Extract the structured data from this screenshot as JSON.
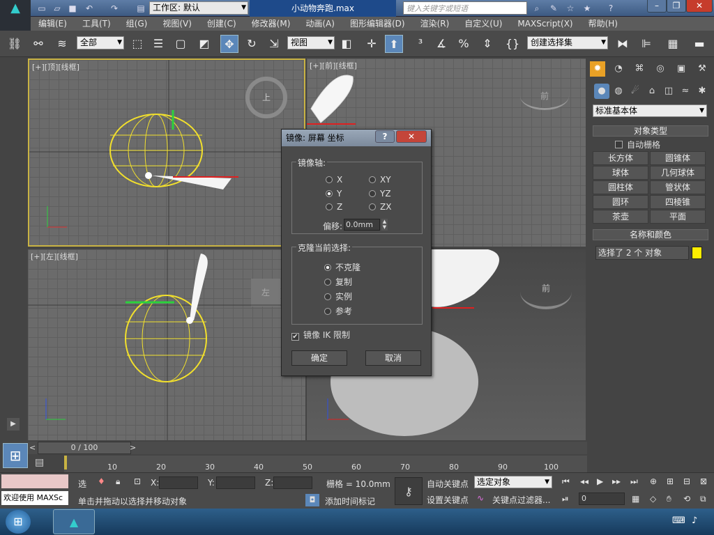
{
  "titlebar": {
    "workspace_label": "工作区: 默认",
    "file_title": "小动物奔跑.max",
    "search_placeholder": "键入关键字或短语"
  },
  "menu": [
    "编辑(E)",
    "工具(T)",
    "组(G)",
    "视图(V)",
    "创建(C)",
    "修改器(M)",
    "动画(A)",
    "图形编辑器(D)",
    "渲染(R)",
    "自定义(U)",
    "MAXScript(X)",
    "帮助(H)"
  ],
  "toolbar": {
    "filter_value": "全部",
    "refcoord_value": "视图",
    "selection_set_value": "创建选择集"
  },
  "viewports": {
    "top": {
      "label": "[+][顶][线框]",
      "cube": "上"
    },
    "front": {
      "label": "[+][前][线框]",
      "cube": "前"
    },
    "left": {
      "label": "[+][左][线框]",
      "cube": "左"
    },
    "persp": {
      "cube": "前"
    }
  },
  "command_panel": {
    "category": "标准基本体",
    "object_type_title": "对象类型",
    "autogrid_label": "自动栅格",
    "primitives": [
      "长方体",
      "圆锥体",
      "球体",
      "几何球体",
      "圆柱体",
      "管状体",
      "圆环",
      "四棱锥",
      "茶壶",
      "平面"
    ],
    "name_color_title": "名称和颜色",
    "name_value": "选择了 2 个 对象",
    "color": "#ffee00"
  },
  "dialog": {
    "title": "镜像: 屏幕 坐标",
    "mirror_axis_label": "镜像轴:",
    "axes": [
      {
        "label": "X",
        "checked": false
      },
      {
        "label": "XY",
        "checked": false
      },
      {
        "label": "Y",
        "checked": true
      },
      {
        "label": "YZ",
        "checked": false
      },
      {
        "label": "Z",
        "checked": false
      },
      {
        "label": "ZX",
        "checked": false
      }
    ],
    "offset_label": "偏移:",
    "offset_value": "0.0mm",
    "clone_label": "克隆当前选择:",
    "clone_options": [
      {
        "label": "不克隆",
        "checked": true
      },
      {
        "label": "复制",
        "checked": false
      },
      {
        "label": "实例",
        "checked": false
      },
      {
        "label": "参考",
        "checked": false
      }
    ],
    "mirror_ik_label": "镜像 IK 限制",
    "mirror_ik_checked": true,
    "ok_label": "确定",
    "cancel_label": "取消"
  },
  "timeline": {
    "position": "0 / 100",
    "ticks": [
      "10",
      "20",
      "30",
      "40",
      "50",
      "60",
      "70",
      "80",
      "90",
      "100"
    ]
  },
  "status": {
    "welcome": "欢迎使用 MAXSc",
    "select_label": "选",
    "x_label": "X:",
    "y_label": "Y:",
    "z_label": "Z:",
    "grid_label": "栅格 = 10.0mm",
    "prompt": "单击并拖动以选择并移动对象",
    "add_time_tag": "添加时间标记",
    "auto_key": "自动关键点",
    "set_key": "设置关键点",
    "key_mode_value": "选定对象",
    "key_filters": "关键点过滤器...",
    "frame_value": "0"
  }
}
